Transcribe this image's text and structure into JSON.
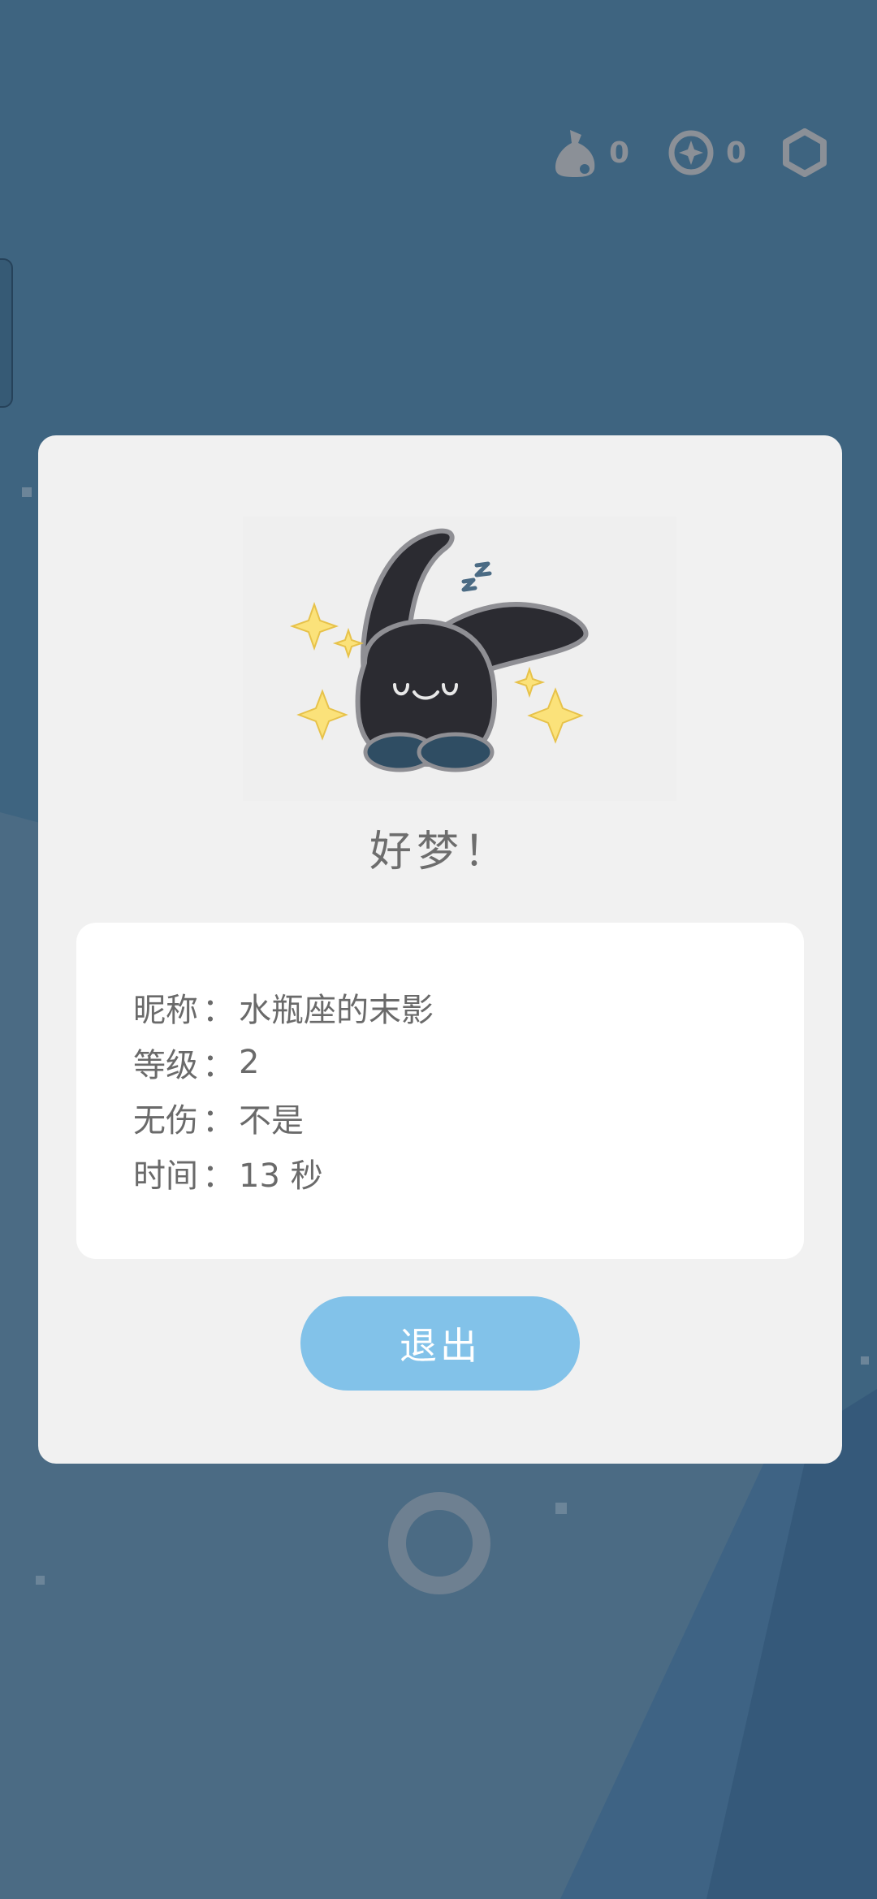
{
  "hud": {
    "bag_count": "0",
    "coin_count": "0"
  },
  "dialog": {
    "title": "好梦！",
    "info": [
      {
        "label": "昵称",
        "separator": "：",
        "value": "水瓶座的末影"
      },
      {
        "label": "等级",
        "separator": "：",
        "value": "2"
      },
      {
        "label": "无伤",
        "separator": "：",
        "value": "不是"
      },
      {
        "label": "时间",
        "separator": "：",
        "value": "13 秒"
      }
    ],
    "exit_label": "退出"
  },
  "colors": {
    "background": "#3e6480",
    "dialog": "#f1f1f1",
    "button": "#82c2e9",
    "hud_icon": "#8b9097"
  },
  "icons": [
    "bag-icon",
    "coin-icon",
    "settings-hexagon-icon",
    "sleeping-rabbit",
    "sparkle-icon"
  ]
}
